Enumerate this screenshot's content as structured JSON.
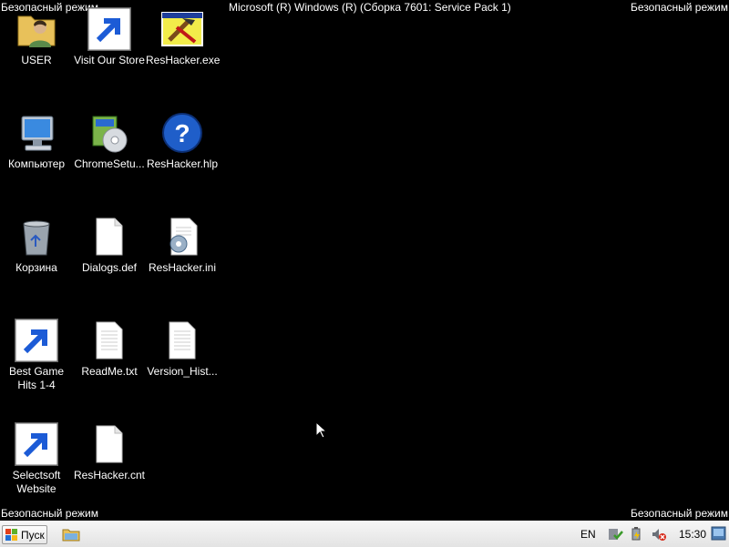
{
  "overlay": {
    "top_left": "Безопасный режим",
    "top_right": "Безопасный режим",
    "bottom_left": "Безопасный режим",
    "bottom_right": "Безопасный режим",
    "center_title": "Microsoft (R) Windows (R) (Сборка 7601: Service Pack 1)"
  },
  "desktop_icons": [
    {
      "label": "USER",
      "icon": "user-folder-icon"
    },
    {
      "label": "Visit Our Store",
      "icon": "store-n-logo-icon",
      "shortcut": true
    },
    {
      "label": "ResHacker.exe",
      "icon": "reshacker-exe-icon"
    },
    {
      "label": "Компьютер",
      "icon": "computer-icon"
    },
    {
      "label": "ChromeSetu...",
      "icon": "installer-icon"
    },
    {
      "label": "ResHacker.hlp",
      "icon": "help-file-icon"
    },
    {
      "label": "Корзина",
      "icon": "recycle-bin-icon"
    },
    {
      "label": "Dialogs.def",
      "icon": "blank-file-icon"
    },
    {
      "label": "ResHacker.ini",
      "icon": "ini-settings-file-icon"
    },
    {
      "label": "Best Game Hits 1-4",
      "icon": "dice-game-icon",
      "shortcut": true
    },
    {
      "label": "ReadMe.txt",
      "icon": "text-file-icon"
    },
    {
      "label": "Version_Hist...",
      "icon": "text-file-icon"
    },
    {
      "label": "Selectsoft Website",
      "icon": "selectsoft-s-icon",
      "shortcut": true
    },
    {
      "label": "ResHacker.cnt",
      "icon": "blank-file-icon"
    }
  ],
  "taskbar": {
    "start_label": "Пуск",
    "language": "EN",
    "clock": "15:30"
  }
}
